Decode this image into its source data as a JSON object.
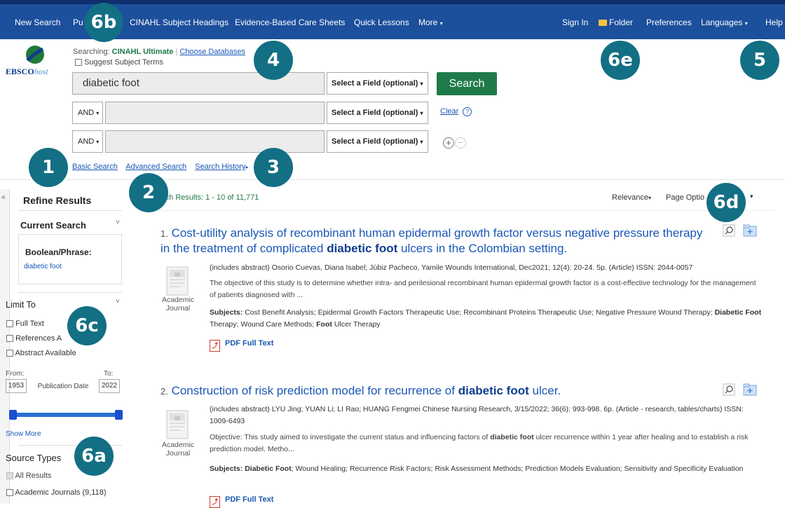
{
  "topnav": {
    "new_search": "New Search",
    "publications": "Pu",
    "subject_headings": "CINAHL Subject Headings",
    "care_sheets": "Evidence-Based Care Sheets",
    "quick_lessons": "Quick Lessons",
    "more": "More",
    "sign_in": "Sign In",
    "folder": "Folder",
    "preferences": "Preferences",
    "languages": "Languages",
    "help": "Help"
  },
  "logo": {
    "ebsco": "EBSCO",
    "host": "host"
  },
  "search": {
    "searching_label": "Searching:",
    "database": "CINAHL Ultimate",
    "choose_db": "Choose Databases",
    "suggest_terms": "Suggest Subject Terms",
    "row1_value": "diabetic foot",
    "field_label": "Select a Field (optional)",
    "bool_label": "AND",
    "search_button": "Search",
    "clear": "Clear",
    "help_q": "?"
  },
  "search_modes": {
    "basic": "Basic Search",
    "advanced": "Advanced Search",
    "history": "Search History"
  },
  "badges": {
    "b1": "1",
    "b2": "2",
    "b3": "3",
    "b4": "4",
    "b5": "5",
    "b6a": "6a",
    "b6b": "6b",
    "b6c": "6c",
    "b6d": "6d",
    "b6e": "6e"
  },
  "sidebar": {
    "collapse": "«",
    "refine": "Refine Results",
    "current_search": "Current Search",
    "boolean_phrase": "Boolean/Phrase:",
    "query": "diabetic foot",
    "limit_to": "Limit To",
    "full_text": "Full Text",
    "references": "References A",
    "abstract": "Abstract Available",
    "from": "From:",
    "to": "To:",
    "from_year": "1953",
    "to_year": "2022",
    "pub_date": "Publication Date",
    "show_more": "Show More",
    "source_types": "Source Types",
    "all_results": "All Results",
    "academic_journals": "Academic Journals (9,118)",
    "date_slider_low": 0,
    "date_slider_high": 1
  },
  "results": {
    "summary": "rch Results: 1 - 10 of 11,771",
    "relevance": "Relevance",
    "page_options": "Page Optio",
    "items": [
      {
        "num": "1.",
        "title_a": "Cost-utility analysis of recombinant human epidermal growth factor versus negative pressure therapy in the treatment of complicated",
        "title_hl": "diabetic foot",
        "title_b": "ulcers in the Colombian setting.",
        "source": "(includes abstract) Osorio Cuevas, Diana Isabel; Júbiz Pacheco, Yamile Wounds International, Dec2021; 12(4): 20-24. 5p. (Article) ISSN: 2044-0057",
        "abstract": "The objective of this study is to determine whether intra- and perilesional recombinant human epidermal growth factor is a cost-effective technology for the management of patients diagnosed with ...",
        "subjects_label": "Subjects:",
        "subjects_a": "Cost Benefit Analysis; Epidermal Growth Factors Therapeutic Use; Recombinant Proteins Therapeutic Use; Negative Pressure Wound Therapy;",
        "subjects_hl1": "Diabetic Foot",
        "subjects_b": "Therapy; Wound Care Methods;",
        "subjects_hl2": "Foot",
        "subjects_c": "Ulcer Therapy",
        "type_line1": "Academic",
        "type_line2": "Journal",
        "pdf": "PDF Full Text"
      },
      {
        "num": "2.",
        "title_a": "Construction of risk prediction model for recurrence of",
        "title_hl": "diabetic foot",
        "title_b": "ulcer.",
        "source": "(includes abstract) LYU Jing; YUAN Li; LI Rao; HUANG Fengmei Chinese Nursing Research, 3/15/2022; 36(6): 993-998. 6p. (Article - research, tables/charts) ISSN: 1009-6493",
        "abstract_a": "Objective: This study aimed to investigate the current status and influencing factors of",
        "abstract_hl": "diabetic foot",
        "abstract_b": "ulcer recurrence within 1 year after healing and to establish a risk prediction model. Metho...",
        "subjects_label": "Subjects:",
        "subjects_hl1": "Diabetic Foot",
        "subjects_a": "; Wound Healing; Recurrence Risk Factors; Risk Assessment Methods; Prediction Models Evaluation; Sensitivity and Specificity Evaluation",
        "type_line1": "Academic",
        "type_line2": "Journal",
        "pdf": "PDF Full Text"
      }
    ]
  },
  "colors": {
    "nav": "#1c4f9c",
    "badge": "#136f84",
    "search_button": "#1f7a4a",
    "link": "#1a57b6"
  }
}
